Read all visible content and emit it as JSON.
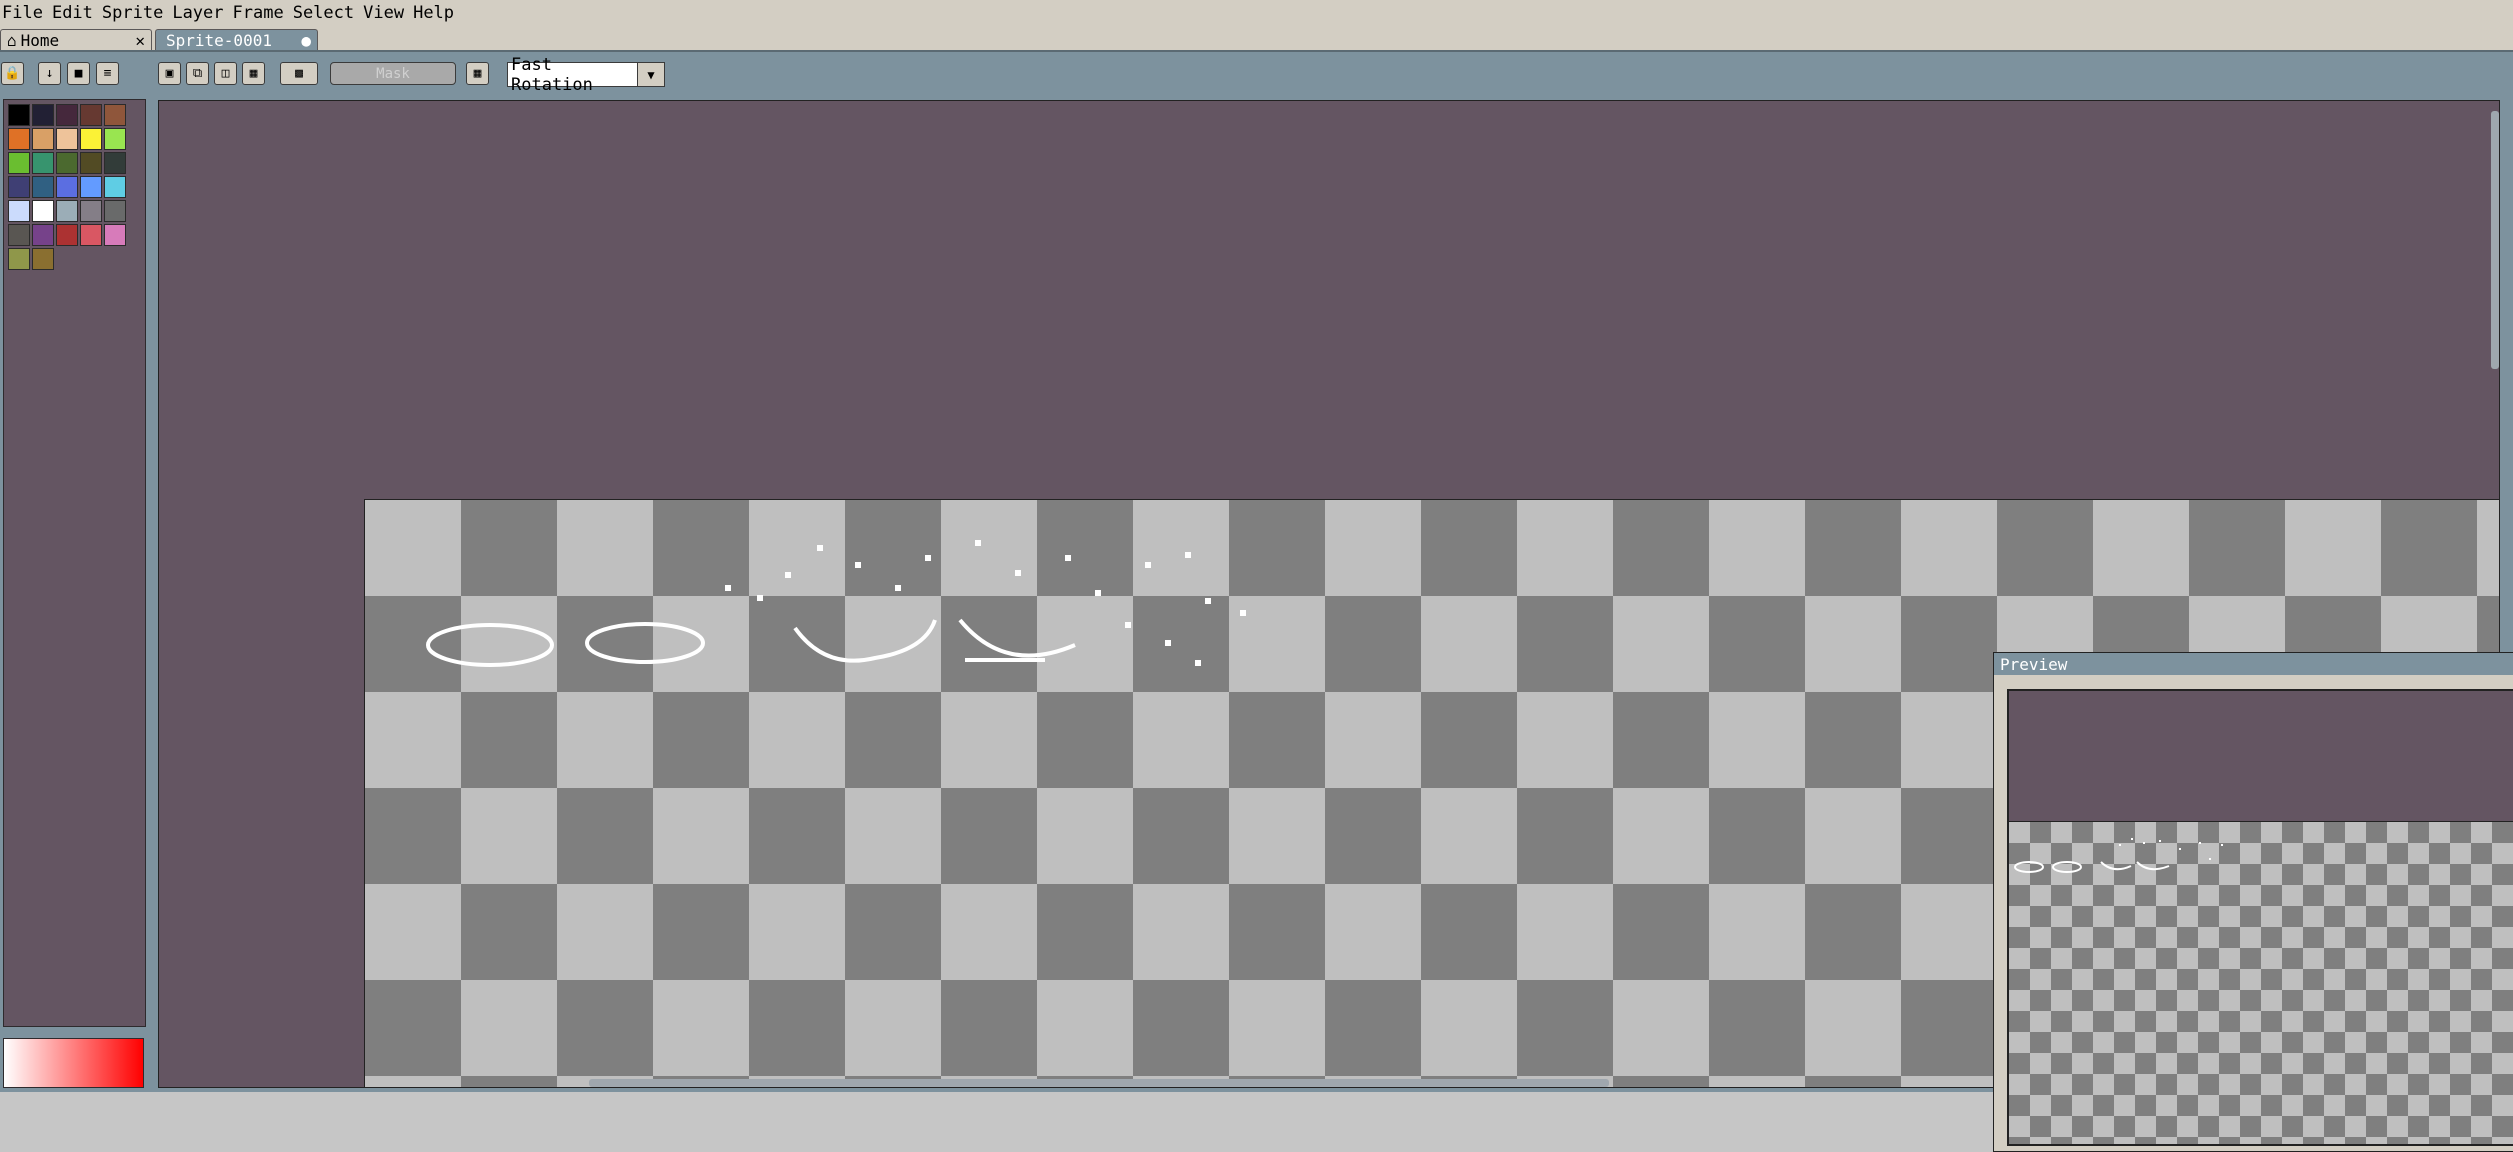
{
  "menu": {
    "items": [
      {
        "label": "File"
      },
      {
        "label": "Edit"
      },
      {
        "label": "Sprite"
      },
      {
        "label": "Layer"
      },
      {
        "label": "Frame"
      },
      {
        "label": "Select"
      },
      {
        "label": "View"
      },
      {
        "label": "Help"
      }
    ]
  },
  "tabs": {
    "home_label": "Home",
    "sprite_label": "Sprite-0001"
  },
  "toolbar": {
    "mask_label": "Mask",
    "rotation_value": "Fast Rotation"
  },
  "palette": {
    "colors": [
      "#000000",
      "#222034",
      "#45283c",
      "#663931",
      "#8f563b",
      "#df7126",
      "#d9a066",
      "#eec39a",
      "#fbf236",
      "#99e550",
      "#6abe30",
      "#37946e",
      "#4b692f",
      "#524b24",
      "#323c39",
      "#3f3f74",
      "#306082",
      "#5b6ee1",
      "#639bff",
      "#5fcde4",
      "#cbdbfc",
      "#ffffff",
      "#9badb7",
      "#847e87",
      "#696a6a",
      "#595652",
      "#76428a",
      "#ac3232",
      "#d95763",
      "#d77bba",
      "#8f974a",
      "#8a6f30"
    ],
    "primary_color": "#ffffff",
    "secondary_color": "#ff0000"
  },
  "preview": {
    "title": "Preview"
  }
}
